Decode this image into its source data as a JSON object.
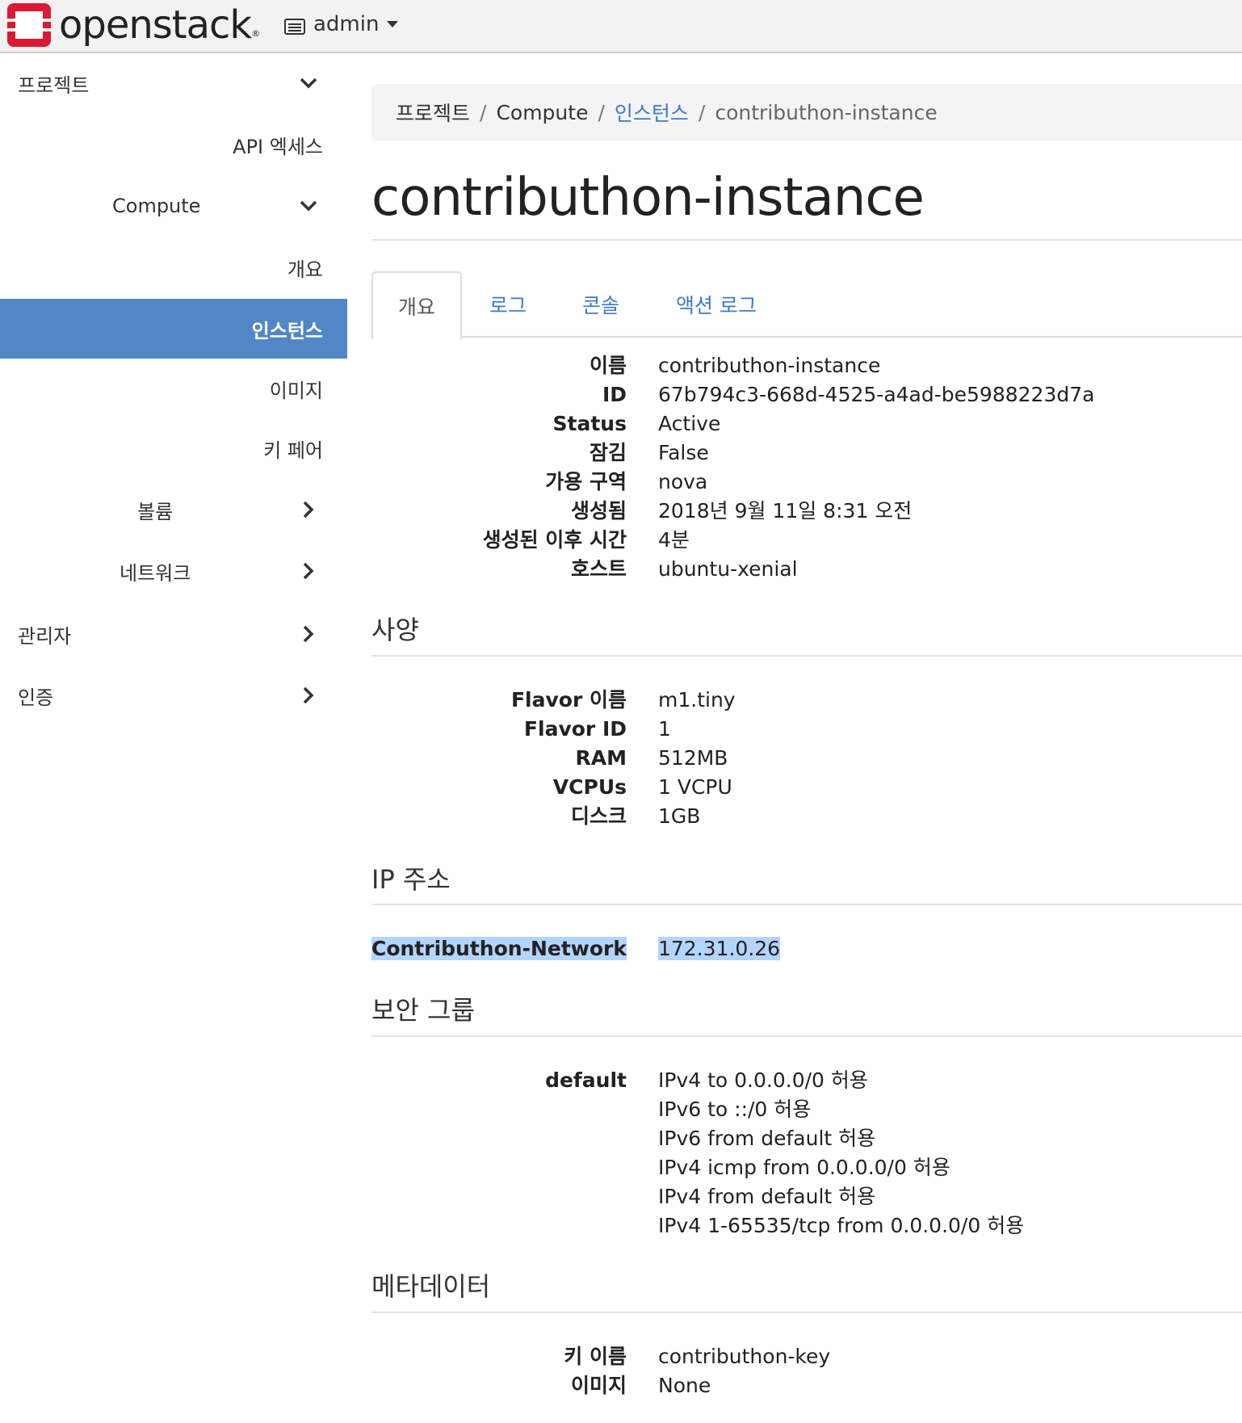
{
  "header": {
    "brand": "openstack",
    "project": "admin"
  },
  "sidebar": {
    "items": [
      {
        "label": "프로젝트",
        "icon": "chevron-down-icon"
      },
      {
        "label": "API 엑세스"
      },
      {
        "label": "Compute",
        "icon": "chevron-down-icon"
      },
      {
        "label": "개요"
      },
      {
        "label": "인스턴스",
        "active": true
      },
      {
        "label": "이미지"
      },
      {
        "label": "키 페어"
      },
      {
        "label": "볼륨",
        "icon": "chevron-right-icon"
      },
      {
        "label": "네트워크",
        "icon": "chevron-right-icon"
      },
      {
        "label": "관리자",
        "icon": "chevron-right-icon"
      },
      {
        "label": "인증",
        "icon": "chevron-right-icon"
      }
    ]
  },
  "breadcrumb": [
    "프로젝트",
    "Compute",
    "인스턴스",
    "contributhon-instance"
  ],
  "page_title": "contributhon-instance",
  "tabs": [
    "개요",
    "로그",
    "콘솔",
    "액션 로그"
  ],
  "overview": [
    {
      "label": "이름",
      "value": "contributhon-instance"
    },
    {
      "label": "ID",
      "value": "67b794c3-668d-4525-a4ad-be5988223d7a"
    },
    {
      "label": "Status",
      "value": "Active"
    },
    {
      "label": "잠김",
      "value": "False"
    },
    {
      "label": "가용 구역",
      "value": "nova"
    },
    {
      "label": "생성됨",
      "value": "2018년 9월 11일 8:31 오전"
    },
    {
      "label": "생성된 이후 시간",
      "value": "4분"
    },
    {
      "label": "호스트",
      "value": "ubuntu-xenial"
    }
  ],
  "specs": {
    "title": "사양",
    "rows": [
      {
        "label": "Flavor 이름",
        "value": "m1.tiny"
      },
      {
        "label": "Flavor ID",
        "value": "1"
      },
      {
        "label": "RAM",
        "value": "512MB"
      },
      {
        "label": "VCPUs",
        "value": "1 VCPU"
      },
      {
        "label": "디스크",
        "value": "1GB"
      }
    ]
  },
  "ip": {
    "title": "IP 주소",
    "rows": [
      {
        "label": "Contributhon-Network",
        "value": "172.31.0.26"
      }
    ]
  },
  "security": {
    "title": "보안 그룹",
    "group": "default",
    "rules": [
      "IPv4 to 0.0.0.0/0 허용",
      "IPv6 to ::/0 허용",
      "IPv6 from default 허용",
      "IPv4 icmp from 0.0.0.0/0 허용",
      "IPv4 from default 허용",
      "IPv4 1-65535/tcp from 0.0.0.0/0 허용"
    ]
  },
  "metadata": {
    "title": "메타데이터",
    "rows": [
      {
        "label": "키 이름",
        "value": "contributhon-key"
      },
      {
        "label": "이미지",
        "value": "None"
      }
    ]
  },
  "colors": {
    "accent": "#5187c6",
    "link": "#3b7cc6",
    "logo": "#da1a32",
    "selection": "#b3d4fc"
  }
}
